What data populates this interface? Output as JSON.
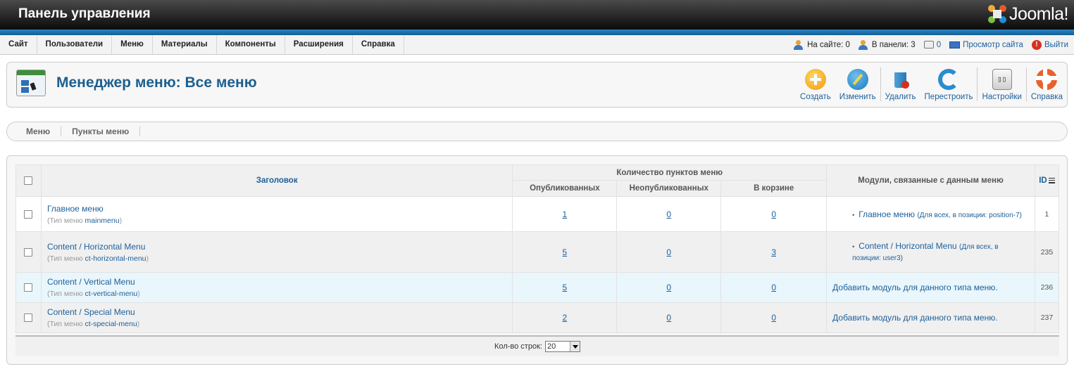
{
  "header": {
    "title": "Панель управления",
    "logo_text": "Joomla!"
  },
  "menu": [
    "Сайт",
    "Пользователи",
    "Меню",
    "Материалы",
    "Компоненты",
    "Расширения",
    "Справка"
  ],
  "status": {
    "on_site": "На сайте: 0",
    "in_panel": "В панели: 3",
    "messages": "0",
    "view_site": "Просмотр сайта",
    "logout": "Выйти"
  },
  "page": {
    "title": "Менеджер меню: Все меню"
  },
  "toolbar": {
    "new": "Создать",
    "edit": "Изменить",
    "delete": "Удалить",
    "rebuild": "Перестроить",
    "options": "Настройки",
    "help": "Справка"
  },
  "submenu": [
    "Меню",
    "Пункты меню"
  ],
  "table": {
    "headers": {
      "title": "Заголовок",
      "count_group": "Количество пунктов меню",
      "published": "Опубликованных",
      "unpublished": "Неопубликованных",
      "trashed": "В корзине",
      "modules": "Модули, связанные с данным меню",
      "id": "ID"
    },
    "type_label": "(Тип меню",
    "type_close": ")",
    "rows": [
      {
        "title": "Главное меню",
        "type": "mainmenu",
        "published": "1",
        "unpublished": "0",
        "trashed": "0",
        "module_name": "Главное меню",
        "module_info": "(Для всех, в позиции: position-7)",
        "id": "1"
      },
      {
        "title": "Content / Horizontal Menu",
        "type": "ct-horizontal-menu",
        "published": "5",
        "unpublished": "0",
        "trashed": "3",
        "module_name": "Content / Horizontal Menu",
        "module_info": "(Для всех, в позиции: user3)",
        "id": "235"
      },
      {
        "title": "Content / Vertical Menu",
        "type": "ct-vertical-menu",
        "published": "5",
        "unpublished": "0",
        "trashed": "0",
        "module_add": "Добавить модуль для данного типа меню.",
        "id": "236"
      },
      {
        "title": "Content / Special Menu",
        "type": "ct-special-menu",
        "published": "2",
        "unpublished": "0",
        "trashed": "0",
        "module_add": "Добавить модуль для данного типа меню.",
        "id": "237"
      }
    ]
  },
  "footer": {
    "limit_label": "Кол-во строк:",
    "limit_value": "20"
  }
}
